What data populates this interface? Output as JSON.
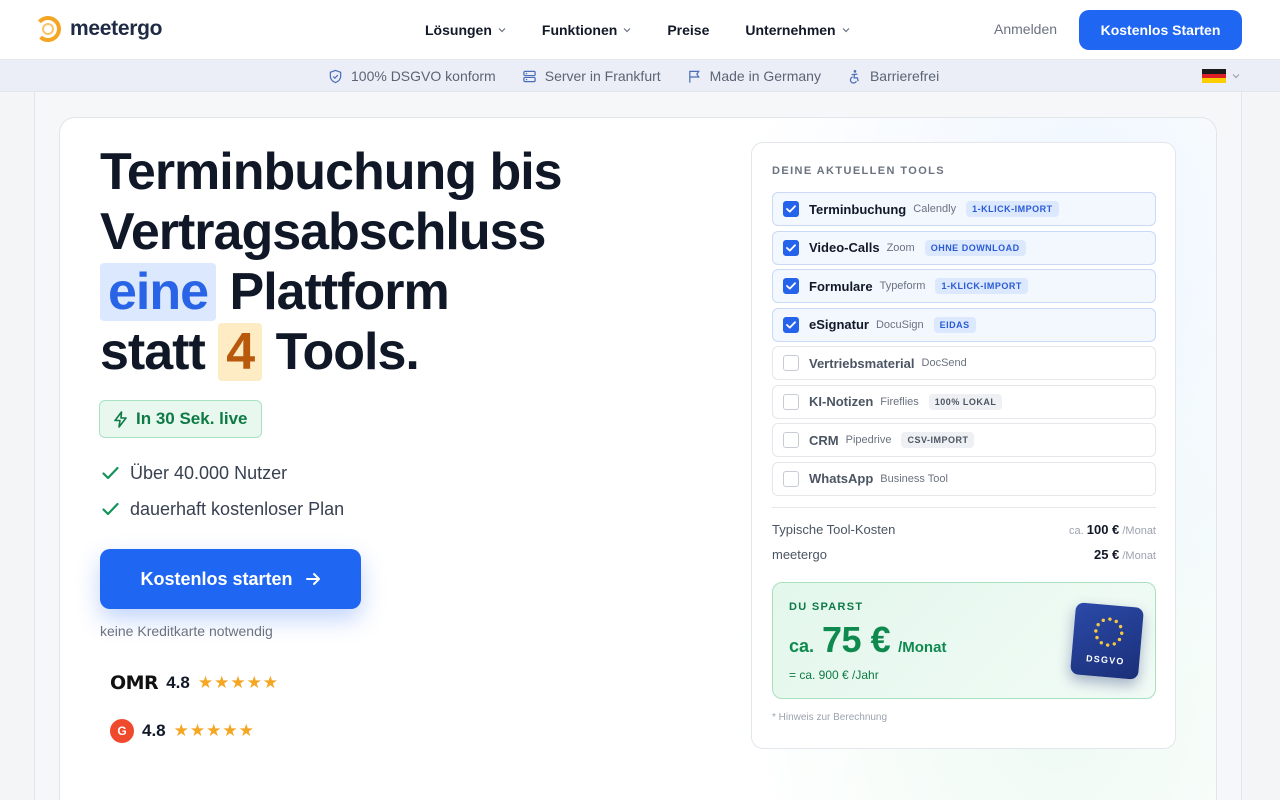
{
  "nav": {
    "logo_text": "meetergo",
    "links": [
      {
        "label": "Lösungen",
        "dropdown": true
      },
      {
        "label": "Funktionen",
        "dropdown": true
      },
      {
        "label": "Preise",
        "dropdown": false
      },
      {
        "label": "Unternehmen",
        "dropdown": true
      }
    ],
    "login": "Anmelden",
    "cta": "Kostenlos Starten",
    "accent": "#1f66f2"
  },
  "trust_bar": {
    "items": [
      {
        "icon": "shield-icon",
        "label": "100% DSGVO konform"
      },
      {
        "icon": "server-icon",
        "label": "Server in Frankfurt"
      },
      {
        "icon": "flag-icon",
        "label": "Made in Germany"
      },
      {
        "icon": "accessibility-icon",
        "label": "Barrierefrei"
      }
    ],
    "language_icon": "german-flag-icon"
  },
  "hero": {
    "headline": {
      "line1": "Terminbuchung bis",
      "line2": "Vertragsabschluss",
      "line3_highlight": "eine",
      "line3_rest": " Plattform",
      "line4_start": "statt ",
      "line4_highlight": "4",
      "line4_rest": " Tools."
    },
    "live_badge": "In 30 Sek. live",
    "checks": [
      "Über 40.000 Nutzer",
      "dauerhaft kostenloser Plan"
    ],
    "cta": "Kostenlos starten",
    "cta_note": "keine Kreditkarte notwendig",
    "ratings": [
      {
        "logo": "OMR",
        "score": "4.8",
        "stars": "★★★★★"
      },
      {
        "logo": "G",
        "score": "4.8",
        "stars": "★★★★★"
      }
    ]
  },
  "tools_card": {
    "title": "DEINE AKTUELLEN TOOLS",
    "tools": [
      {
        "name": "Terminbuchung",
        "sub": "Calendly",
        "tag": "1-KLICK-IMPORT",
        "checked": true
      },
      {
        "name": "Video-Calls",
        "sub": "Zoom",
        "tag": "OHNE DOWNLOAD",
        "checked": true
      },
      {
        "name": "Formulare",
        "sub": "Typeform",
        "tag": "1-KLICK-IMPORT",
        "checked": true
      },
      {
        "name": "eSignatur",
        "sub": "DocuSign",
        "tag": "EIDAS",
        "checked": true
      },
      {
        "name": "Vertriebsmaterial",
        "sub": "DocSend",
        "tag": "",
        "checked": false
      },
      {
        "name": "KI-Notizen",
        "sub": "Fireflies",
        "tag": "100% LOKAL",
        "checked": false
      },
      {
        "name": "CRM",
        "sub": "Pipedrive",
        "tag": "CSV-IMPORT",
        "checked": false
      },
      {
        "name": "WhatsApp",
        "sub": "Business Tool",
        "tag": "",
        "checked": false
      }
    ],
    "costs": [
      {
        "label": "Typische Tool-Kosten",
        "prefix": "ca.",
        "amount": "100 €",
        "unit": "/Monat"
      },
      {
        "label": "meetergo",
        "prefix": "",
        "amount": "25 €",
        "unit": "/Monat"
      }
    ],
    "savings": {
      "label": "DU SPARST",
      "prefix": "ca.",
      "amount": "75 €",
      "unit": "/Monat",
      "yearly": "= ca. 900 € /Jahr",
      "seal_text": "DSGVO"
    },
    "footnote": "* Hinweis zur Berechnung"
  }
}
